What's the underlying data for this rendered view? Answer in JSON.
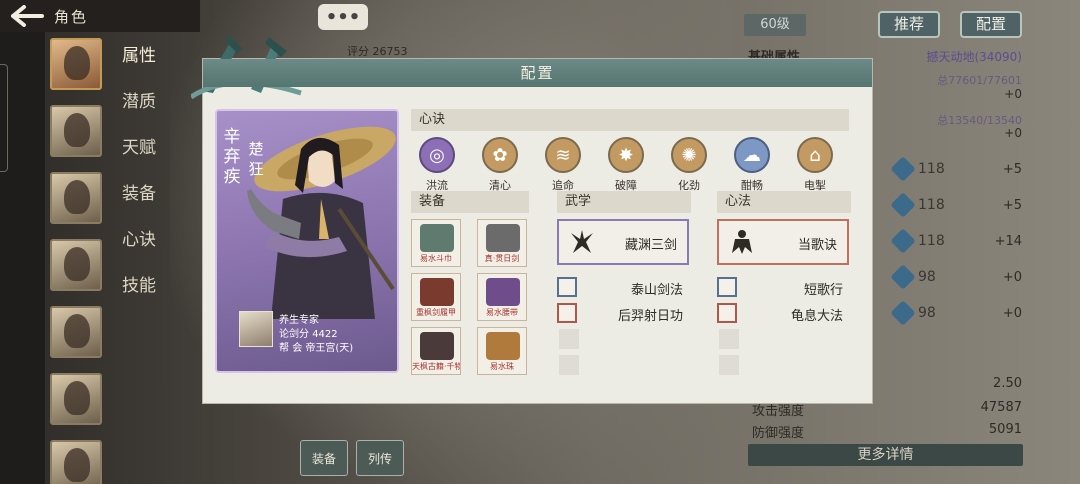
{
  "topbar": {
    "title": "角色"
  },
  "sidemenu": [
    "属性",
    "潜质",
    "天赋",
    "装备",
    "心诀",
    "技能"
  ],
  "right_panel": {
    "level": "60级",
    "recommend_btn": "推荐",
    "config_btn": "配置",
    "stat_header": "基础属性",
    "stat_header_value": "撼天动地(34090)",
    "hp_total": "总77601/77601",
    "hp_bonus": "+0",
    "mp_total": "总13540/13540",
    "mp_bonus": "+0",
    "attributes": [
      {
        "value": "118",
        "bonus": "+5"
      },
      {
        "value": "118",
        "bonus": "+5"
      },
      {
        "value": "118",
        "bonus": "+14"
      },
      {
        "value": "98",
        "bonus": "+0"
      },
      {
        "value": "98",
        "bonus": "+0"
      }
    ],
    "extra_value": "2.50",
    "attack_label": "攻击强度",
    "attack_value": "47587",
    "defense_label": "防御强度",
    "defense_value": "5091",
    "more_details": "更多详情"
  },
  "bottom_tabs": [
    "装备",
    "列传"
  ],
  "modal": {
    "title": "配置",
    "score_label": "评分",
    "score_value": "26753",
    "character": {
      "name": "辛弃疾",
      "nickname": "楚狂",
      "title": "养生专家",
      "lunjian_label": "论剑分",
      "lunjian_value": "4422",
      "guild_label": "帮",
      "guild_value": "会 帝王宫(天)"
    },
    "xinjue_header": "心诀",
    "xinjue": [
      {
        "label": "洪流",
        "color": "#7b5aa8"
      },
      {
        "label": "清心",
        "color": "#b07e3e"
      },
      {
        "label": "追命",
        "color": "#b07e3e"
      },
      {
        "label": "破障",
        "color": "#b07e3e"
      },
      {
        "label": "化劲",
        "color": "#b07e3e"
      },
      {
        "label": "酣畅",
        "color": "#4e6ea8"
      },
      {
        "label": "电掣",
        "color": "#b07e3e"
      }
    ],
    "equip_header": "装备",
    "equipment": [
      {
        "label": "易水斗巾",
        "color": "#5f7a6e"
      },
      {
        "label": "真·贯日剑",
        "color": "#6b6b6b"
      },
      {
        "label": "重枫剑履甲",
        "color": "#7a3b2e"
      },
      {
        "label": "易水腰带",
        "color": "#6e4d8a"
      },
      {
        "label": "天枫古籍·千物",
        "color": "#4a3a3a"
      },
      {
        "label": "易水珠",
        "color": "#b07a3c"
      }
    ],
    "wuxue_header": "武学",
    "wuxue_main": "藏渊三剑",
    "wuxue_sub": [
      "泰山剑法",
      "后羿射日功"
    ],
    "xinfa_header": "心法",
    "xinfa_main": "当歌诀",
    "xinfa_sub": [
      "短歌行",
      "龟息大法"
    ]
  }
}
